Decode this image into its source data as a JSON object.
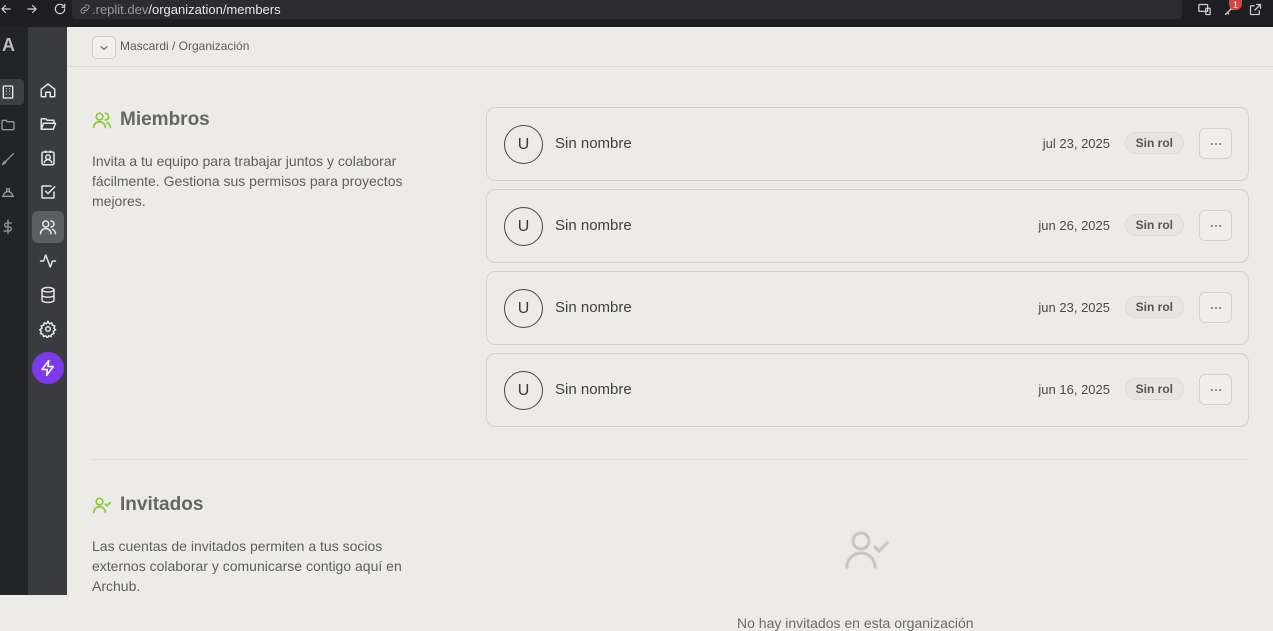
{
  "browser": {
    "url_domain": ".replit.dev",
    "url_path": "/organization/members",
    "notification_count": "1"
  },
  "rail": {
    "logo": "A"
  },
  "breadcrumb": {
    "text": "Mascardi / Organización"
  },
  "members": {
    "title": "Miembros",
    "description": "Invita a tu equipo para trabajar juntos y colaborar fácilmente. Gestiona sus permisos para proyectos mejores.",
    "list": [
      {
        "initial": "U",
        "name": "Sin nombre",
        "date": "jul 23, 2025",
        "role": "Sin rol"
      },
      {
        "initial": "U",
        "name": "Sin nombre",
        "date": "jun 26, 2025",
        "role": "Sin rol"
      },
      {
        "initial": "U",
        "name": "Sin nombre",
        "date": "jun 23, 2025",
        "role": "Sin rol"
      },
      {
        "initial": "U",
        "name": "Sin nombre",
        "date": "jun 16, 2025",
        "role": "Sin rol"
      }
    ]
  },
  "guests": {
    "title": "Invitados",
    "description": "Las cuentas de invitados permiten a tus socios externos colaborar y comunicarse contigo aquí en Archub.",
    "empty_text": "No hay invitados en esta organización"
  },
  "colors": {
    "accent_green": "#8ac936",
    "bolt_purple": "#7c3aed",
    "background": "#ecebe7"
  },
  "icons": [
    "arrow-left-icon",
    "arrow-right-icon",
    "reload-icon",
    "link-icon",
    "devices-icon",
    "key-icon",
    "external-link-icon",
    "building-icon",
    "folder-icon",
    "brush-icon",
    "helmet-icon",
    "dollar-icon",
    "home-icon",
    "folder-open-icon",
    "contact-icon",
    "check-square-icon",
    "users-icon",
    "activity-icon",
    "database-icon",
    "gear-icon",
    "bolt-icon",
    "chevron-down-icon",
    "more-horizontal-icon",
    "user-check-icon"
  ]
}
